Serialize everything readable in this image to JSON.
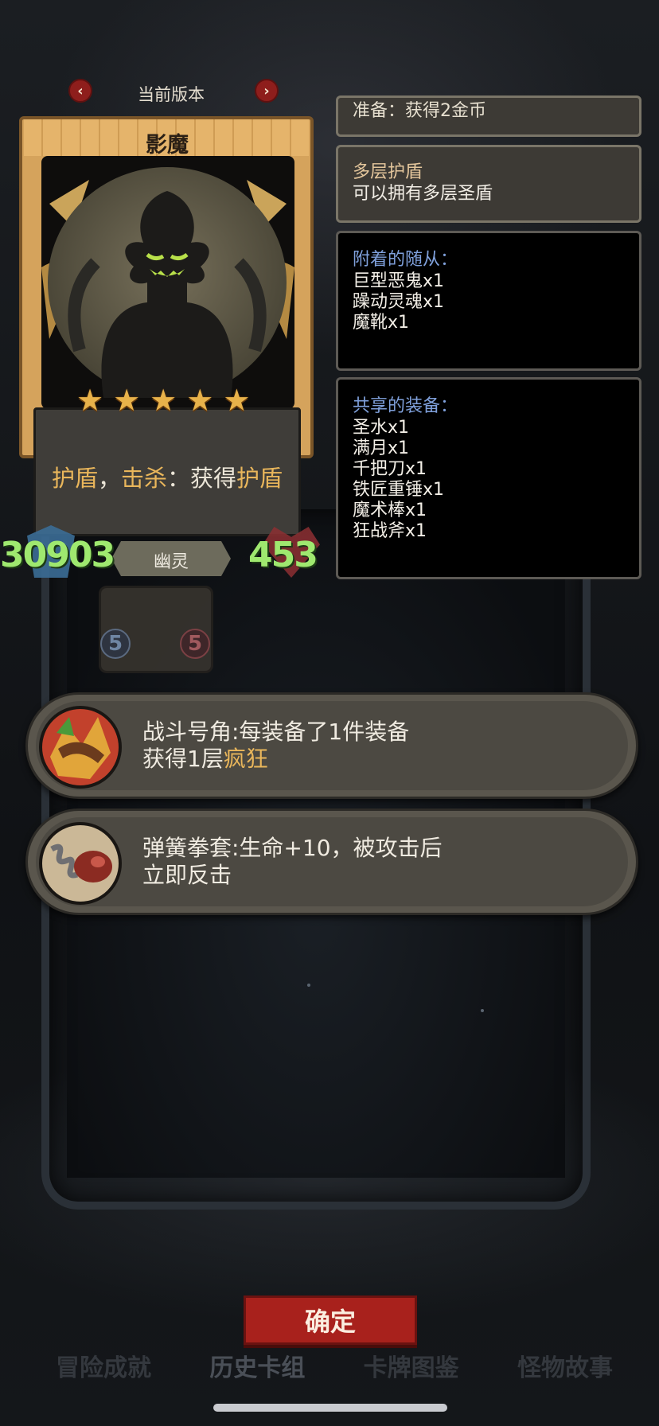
{
  "version": {
    "label": "当前版本",
    "prev_icon": "‹",
    "next_icon": "›"
  },
  "card": {
    "name": "影魔",
    "stars": [
      "★",
      "★",
      "★",
      "★",
      "★"
    ],
    "desc": {
      "p1": "护盾",
      "p2": "，",
      "p3": "击杀",
      "p4": "：获得",
      "p5": "护盾"
    },
    "race": "幽灵",
    "attack": "30903",
    "health": "453"
  },
  "mini_card": {
    "left_badge": "5",
    "right_badge": "5"
  },
  "panels": {
    "prep": {
      "line": "准备：获得2金币"
    },
    "multi_shield": {
      "title": "多层护盾",
      "line": "可以拥有多层圣盾"
    },
    "minions": {
      "title": "附着的随从：",
      "items": [
        "巨型恶鬼x1",
        "躁动灵魂x1",
        "魔靴x1"
      ]
    },
    "equipment": {
      "title": "共享的装备：",
      "items": [
        "圣水x1",
        "满月x1",
        "千把刀x1",
        "铁匠重锤x1",
        "魔术棒x1",
        "狂战斧x1"
      ]
    }
  },
  "relics": [
    {
      "line1": "战斗号角:每装备了1件装备",
      "line2a": "获得1层",
      "line2b": "疯狂"
    },
    {
      "line1": "弹簧拳套:生命+10，被攻击后",
      "line2": "立即反击"
    }
  ],
  "confirm": "确定",
  "tabs": [
    "冒险成就",
    "历史卡组",
    "卡牌图鉴",
    "怪物故事"
  ]
}
